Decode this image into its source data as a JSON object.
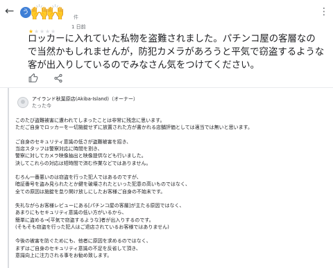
{
  "header": {
    "back_icon": "arrow-left-icon",
    "avatar_initial": "う",
    "avatar_sticker": "🙌🙌",
    "reviewer_suffix": "件",
    "more_icon": "more-vertical-icon"
  },
  "review": {
    "rating": 1,
    "max_rating": 5,
    "time": "1 日前",
    "text": "ロッカーに入れていた私物を盗難されました。パチンコ屋の客層なので当然かもしれませんが，防犯カメラがあろうと平気で窃盗するような客が出入りしているのでみなさん気をつけてください。",
    "like_icon": "thumbs-up-icon",
    "share_icon": "share-icon"
  },
  "owner_reply": {
    "name": "アイランド秋葉原店(Akiba-Island)（オーナー）",
    "time": "たった今",
    "paragraphs": [
      "このたび盗難被害に遭われてしまったことは非常に残念に思います。\nただご自身でロッカーを一切施錠せずに放置された方が書かれる店舗評価としては適当では無いと思います。",
      "ご自身のセキュリティ意識の低さが盗難被害を招き、\n当店スタッフは警察対応に時間を割き、\n警察に対してカメラ映像抽出と映像提供なども行いました。\n決してこれらの対応は短時間で済む作業などではありません。",
      "むろん一番悪いのは窃盗を行った犯人ではあるのですが、\n暗証番号を盗み見られたとか鍵を破壊されたといった犯意の高いものではなく、\n全ての原因は施錠を怠り開け放しにしたお客様ご自身の不始末です。",
      "失礼ながらお客様レビューにある[パチンコ屋の客層]が主たる原因ではなく、\nあまりにもセキュリティ意識の低い方がいるから、\n簡単に盗める→[平気で窃盗するような]者が出入りするのです。\n(そもそも窃盗を行った犯人はご退店されているお客様ではありません)",
      "今後の被害を防ぐためにも、他者に原因を求めるのではなく、\nまずはご自身のセキュリティ意識の不足を反省して頂き、\n意識向上に注力される事をお勧め致します。"
    ]
  }
}
